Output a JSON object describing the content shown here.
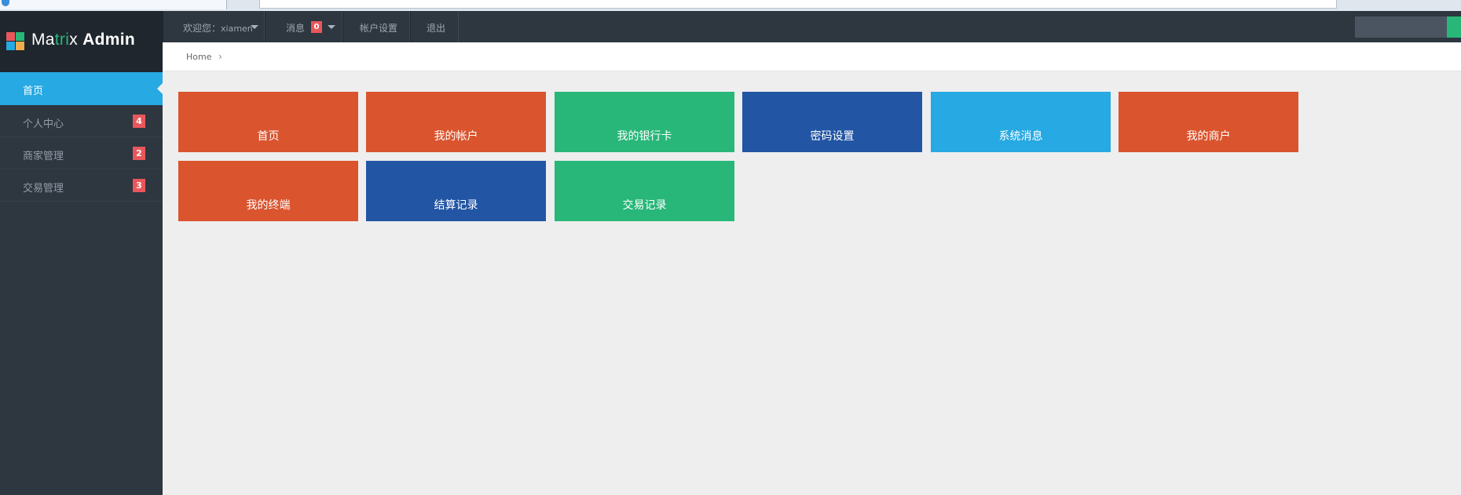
{
  "sidebar": {
    "logo": {
      "part1": "Ma",
      "part2": "tri",
      "part3": "x ",
      "part4": "Admin"
    },
    "logo_colors": [
      "#e9575b",
      "#28b779",
      "#27a9e3",
      "#f0ad4e"
    ],
    "items": [
      {
        "label": "首页",
        "active": true
      },
      {
        "label": "个人中心",
        "badge": "4"
      },
      {
        "label": "商家管理",
        "badge": "2"
      },
      {
        "label": "交易管理",
        "badge": "3"
      }
    ]
  },
  "topnav": {
    "welcome_label": "欢迎您：",
    "username": "xiamen",
    "messages_label": "消息",
    "messages_count": "0",
    "account_settings": "帐户设置",
    "logout": "退出"
  },
  "breadcrumb": {
    "home": "Home",
    "separator": "›"
  },
  "tiles": [
    {
      "label": "首页",
      "color": "#da542e"
    },
    {
      "label": "我的帐户",
      "color": "#da542e"
    },
    {
      "label": "我的银行卡",
      "color": "#28b779"
    },
    {
      "label": "密码设置",
      "color": "#2255a4"
    },
    {
      "label": "系统消息",
      "color": "#27a9e3"
    },
    {
      "label": "我的商户",
      "color": "#da542e"
    },
    {
      "label": "我的终端",
      "color": "#da542e"
    },
    {
      "label": "结算记录",
      "color": "#2255a4"
    },
    {
      "label": "交易记录",
      "color": "#28b779"
    }
  ]
}
